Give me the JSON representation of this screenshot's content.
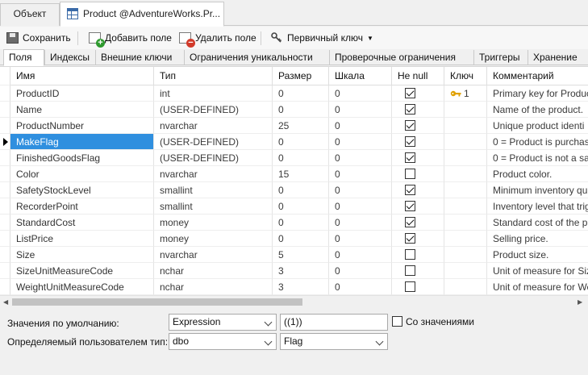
{
  "doc_tabs": [
    {
      "label": "Объект"
    },
    {
      "label": "Product @AdventureWorks.Pr..."
    }
  ],
  "toolbar": {
    "save": "Сохранить",
    "add_field": "Добавить поле",
    "delete_field": "Удалить поле",
    "primary_key": "Первичный ключ"
  },
  "sub_tabs": [
    "Поля",
    "Индексы",
    "Внешние ключи",
    "Ограничения уникальности",
    "Проверочные ограничения",
    "Триггеры",
    "Хранение"
  ],
  "grid": {
    "columns": [
      "Имя",
      "Тип",
      "Размер",
      "Шкала",
      "Не null",
      "Ключ",
      "Комментарий"
    ],
    "rows": [
      {
        "name": "ProductID",
        "type": "int",
        "size": "0",
        "scale": "0",
        "notnull": true,
        "key": "1",
        "comment": "Primary key for Produc"
      },
      {
        "name": "Name",
        "type": "(USER-DEFINED)",
        "size": "0",
        "scale": "0",
        "notnull": true,
        "key": "",
        "comment": "Name of the product."
      },
      {
        "name": "ProductNumber",
        "type": "nvarchar",
        "size": "25",
        "scale": "0",
        "notnull": true,
        "key": "",
        "comment": "Unique product identi"
      },
      {
        "name": "MakeFlag",
        "type": "(USER-DEFINED)",
        "size": "0",
        "scale": "0",
        "notnull": true,
        "key": "",
        "comment": "0 = Product is purchas"
      },
      {
        "name": "FinishedGoodsFlag",
        "type": "(USER-DEFINED)",
        "size": "0",
        "scale": "0",
        "notnull": true,
        "key": "",
        "comment": "0 = Product is not a sa"
      },
      {
        "name": "Color",
        "type": "nvarchar",
        "size": "15",
        "scale": "0",
        "notnull": false,
        "key": "",
        "comment": "Product color."
      },
      {
        "name": "SafetyStockLevel",
        "type": "smallint",
        "size": "0",
        "scale": "0",
        "notnull": true,
        "key": "",
        "comment": "Minimum inventory qu"
      },
      {
        "name": "RecorderPoint",
        "type": "smallint",
        "size": "0",
        "scale": "0",
        "notnull": true,
        "key": "",
        "comment": "Inventory level that trig"
      },
      {
        "name": "StandardCost",
        "type": "money",
        "size": "0",
        "scale": "0",
        "notnull": true,
        "key": "",
        "comment": "Standard cost of the p"
      },
      {
        "name": "ListPrice",
        "type": "money",
        "size": "0",
        "scale": "0",
        "notnull": true,
        "key": "",
        "comment": "Selling price."
      },
      {
        "name": "Size",
        "type": "nvarchar",
        "size": "5",
        "scale": "0",
        "notnull": false,
        "key": "",
        "comment": "Product size."
      },
      {
        "name": "SizeUnitMeasureCode",
        "type": "nchar",
        "size": "3",
        "scale": "0",
        "notnull": false,
        "key": "",
        "comment": "Unit of measure for Siz"
      },
      {
        "name": "WeightUnitMeasureCode",
        "type": "nchar",
        "size": "3",
        "scale": "0",
        "notnull": false,
        "key": "",
        "comment": "Unit of measure for We"
      }
    ],
    "selected_row": 3
  },
  "properties": {
    "default_label": "Значения по умолчанию:",
    "default_kind": "Expression",
    "default_value": "((1))",
    "with_values_label": "Со значениями",
    "with_values_checked": false,
    "udt_label": "Определяемый пользователем тип:",
    "udt_schema": "dbo",
    "udt_name": "Flag"
  },
  "colors": {
    "selection": "#2f8fdf",
    "key_icon": "#e0a100"
  }
}
